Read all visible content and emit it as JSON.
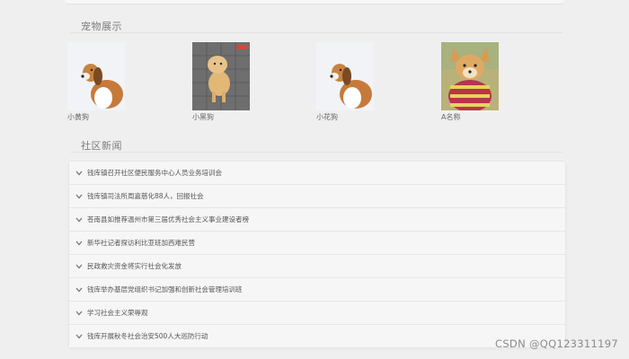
{
  "pets": {
    "title": "宠物展示",
    "items": [
      {
        "name": "小黄狗"
      },
      {
        "name": "小黑狗"
      },
      {
        "name": "小花狗"
      },
      {
        "name": "A名称"
      }
    ]
  },
  "news": {
    "title": "社区新闻",
    "items": [
      "钱库镇召开社区便民服务中心人员业务培训会",
      "钱库镇司法所周嘉慈化88人，回报社会",
      "苍南县如推荐温州市第三届优秀社会主义事业建设者榜",
      "新华社记者探访利比亚班加西难民营",
      "民政救灾资金将实行社会化发放",
      "钱库举办基层党组织书记加强和创新社会管理培训班",
      "学习社会主义荣辱观",
      "钱库开展秋冬社会治安500人大巡防行动"
    ]
  },
  "watermark": "CSDN @QQ123311197",
  "colors": {
    "background": "#efefef",
    "list_background": "#f6f6f6",
    "border": "#e6e6e6",
    "text": "#555555"
  }
}
